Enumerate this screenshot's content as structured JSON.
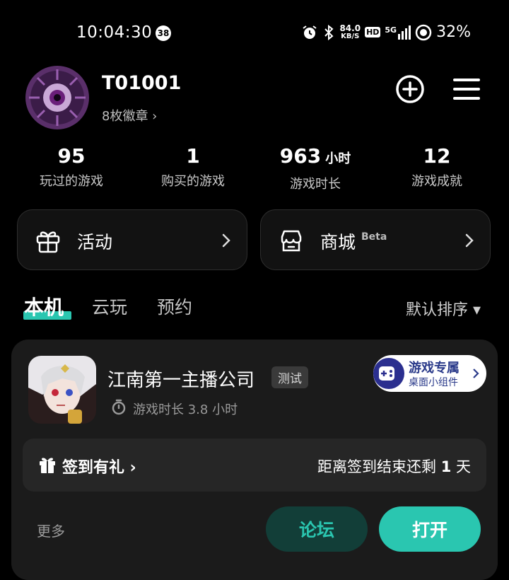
{
  "status_bar": {
    "time": "10:04:30",
    "notification_count": "38",
    "net_speed_value": "84.0",
    "net_speed_unit": "KB/S",
    "hd_label": "HD",
    "signal_label": "5G",
    "battery": "32%"
  },
  "profile": {
    "username": "T01001",
    "badges": "8枚徽章 ›"
  },
  "stats": [
    {
      "value": "95",
      "unit": "",
      "label": "玩过的游戏"
    },
    {
      "value": "1",
      "unit": "",
      "label": "购买的游戏"
    },
    {
      "value": "963",
      "unit": "小时",
      "label": "游戏时长"
    },
    {
      "value": "12",
      "unit": "",
      "label": "游戏成就"
    }
  ],
  "cards": {
    "activity": "活动",
    "store": "商城",
    "store_badge": "Beta"
  },
  "tabs": {
    "local": "本机",
    "cloud": "云玩",
    "reserve": "预约",
    "sort": "默认排序 ▾"
  },
  "game": {
    "title": "江南第一主播公司",
    "tag": "测试",
    "playtime": "游戏时长 3.8 小时",
    "widget_title": "游戏专属",
    "widget_sub": "桌面小组件",
    "checkin_label": "签到有礼 ›",
    "checkin_right_prefix": "距离签到结束还剩",
    "checkin_days": "1",
    "checkin_right_suffix": "天",
    "more": "更多",
    "forum": "论坛",
    "open": "打开"
  },
  "colors": {
    "accent": "#2ac6b0",
    "accent_dark": "#123e38",
    "background": "#000000",
    "card": "#1b1b1b"
  }
}
